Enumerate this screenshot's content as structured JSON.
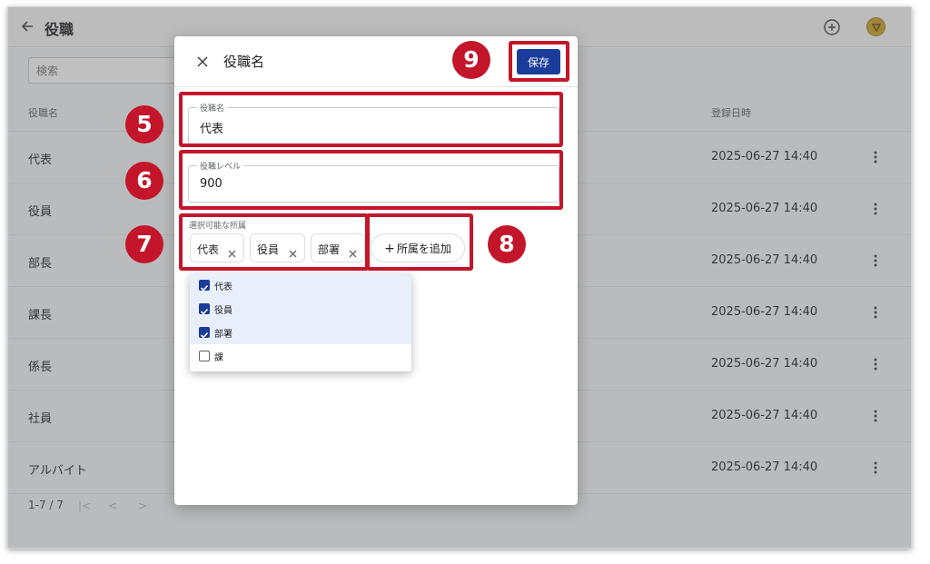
{
  "app": {
    "title": "役職",
    "search_placeholder": "検索",
    "columns": {
      "name": "役職名",
      "registered": "登録日時"
    },
    "rows": [
      {
        "name": "代表",
        "date": "2025-06-27 14:40"
      },
      {
        "name": "役員",
        "date": "2025-06-27 14:40"
      },
      {
        "name": "部長",
        "date": "2025-06-27 14:40"
      },
      {
        "name": "課長",
        "date": "2025-06-27 14:40"
      },
      {
        "name": "係長",
        "date": "2025-06-27 14:40"
      },
      {
        "name": "社員",
        "date": "2025-06-27 14:40"
      },
      {
        "name": "アルバイト",
        "date": "2025-06-27 14:40"
      }
    ],
    "pagination": {
      "range": "1-7 / 7",
      "first": "|<",
      "prev": "<",
      "next": ">"
    }
  },
  "dialog": {
    "title": "役職名",
    "save_label": "保存",
    "name_field": {
      "label": "役職名",
      "value": "代表"
    },
    "level_field": {
      "label": "役職レベル",
      "value": "900"
    },
    "affiliation": {
      "label": "選択可能な所属",
      "chips": [
        "代表",
        "役員",
        "部署"
      ],
      "add_label": "所属を追加",
      "options": [
        {
          "label": "代表",
          "checked": true
        },
        {
          "label": "役員",
          "checked": true
        },
        {
          "label": "部署",
          "checked": true
        },
        {
          "label": "課",
          "checked": false
        }
      ]
    }
  },
  "callouts": {
    "name": "5",
    "level": "6",
    "affiliation": "7",
    "add": "8",
    "save": "9"
  },
  "colors": {
    "callout": "#c3162b",
    "primary": "#1a3d9c",
    "selected_row": "#e8eefa"
  }
}
